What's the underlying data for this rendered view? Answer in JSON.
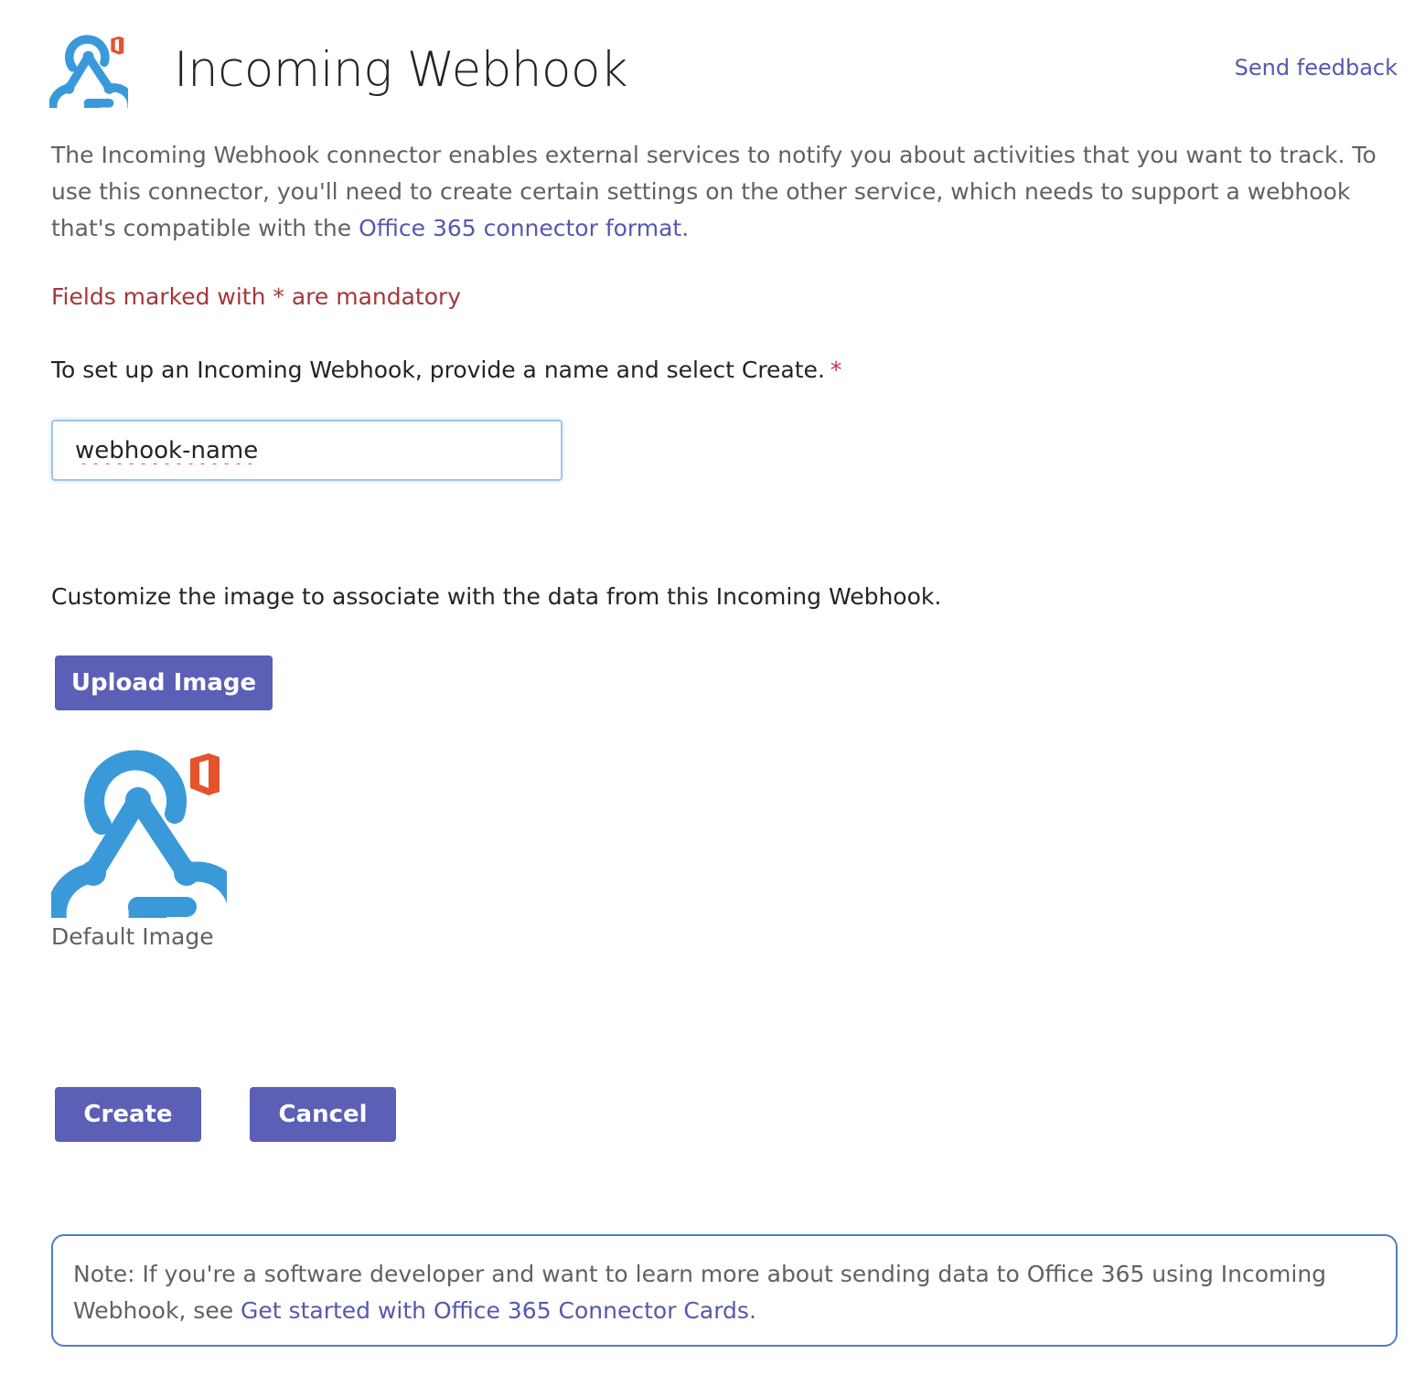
{
  "header": {
    "title": "Incoming Webhook",
    "send_feedback": "Send feedback",
    "logo_icon": "webhook-office-icon"
  },
  "intro": {
    "text_before_link": "The Incoming Webhook connector enables external services to notify you about activities that you want to track. To use this connector, you'll need to create certain settings on the other service, which needs to support a webhook that's compatible with the ",
    "link_text": "Office 365 connector format",
    "text_after_link": "."
  },
  "form": {
    "mandatory_notice": "Fields marked with * are mandatory",
    "name_label": "To set up an Incoming Webhook, provide a name and select Create.",
    "required_marker": "*",
    "name_value": "webhook-name",
    "customize_label": "Customize the image to associate with the data from this Incoming Webhook.",
    "upload_button": "Upload Image",
    "default_image_caption": "Default Image",
    "create_button": "Create",
    "cancel_button": "Cancel"
  },
  "note": {
    "text_before_link": "Note: If you're a software developer and want to learn more about sending data to Office 365 using Incoming Webhook, see ",
    "link_text": "Get started with Office 365 Connector Cards",
    "text_after_link": "."
  },
  "colors": {
    "accent": "#5b5fb6",
    "link": "#5558af",
    "mandatory": "#a4373a",
    "webhook_blue": "#3a9ad9",
    "office_orange": "#e5532d"
  }
}
